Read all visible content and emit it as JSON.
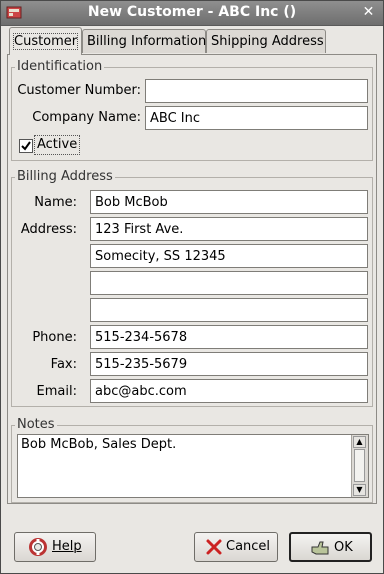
{
  "window": {
    "title": "New Customer - ABC Inc ()"
  },
  "tabs": [
    {
      "label": "Customer",
      "active": true
    },
    {
      "label": "Billing Information",
      "active": false
    },
    {
      "label": "Shipping Address",
      "active": false
    }
  ],
  "identification": {
    "section_label": "Identification",
    "customer_number_label": "Customer Number:",
    "customer_number_value": "",
    "company_name_label": "Company Name:",
    "company_name_value": "ABC Inc",
    "active_label": "Active",
    "active_checked": true
  },
  "billing_address": {
    "section_label": "Billing Address",
    "name_label": "Name:",
    "name_value": "Bob McBob",
    "address_label": "Address:",
    "address_lines": [
      "123 First Ave.",
      "Somecity, SS 12345",
      "",
      ""
    ],
    "phone_label": "Phone:",
    "phone_value": "515-234-5678",
    "fax_label": "Fax:",
    "fax_value": "515-235-5679",
    "email_label": "Email:",
    "email_value": "abc@abc.com"
  },
  "notes": {
    "section_label": "Notes",
    "value": "Bob McBob, Sales Dept."
  },
  "buttons": {
    "help_label": "Help",
    "cancel_label": "Cancel",
    "ok_label": "OK"
  }
}
